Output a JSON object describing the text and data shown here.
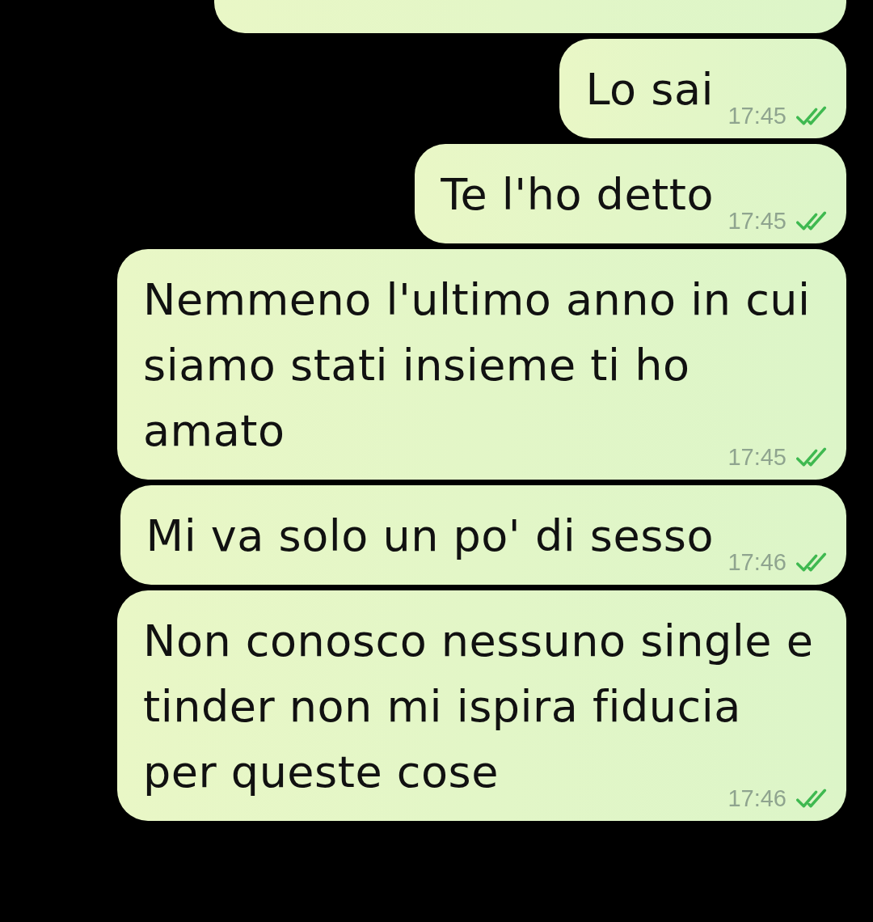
{
  "messages": [
    {
      "text": "Lo sai",
      "time": "17:45",
      "read": true
    },
    {
      "text": "Te l'ho detto",
      "time": "17:45",
      "read": true
    },
    {
      "text": "Nemmeno l'ultimo anno in cui siamo stati insieme ti ho amato",
      "time": "17:45",
      "read": true
    },
    {
      "text": "Mi va solo un po' di sesso",
      "time": "17:46",
      "read": true
    },
    {
      "text": "Non conosco nessuno single e tinder non mi ispira fiducia per queste cose",
      "time": "17:46",
      "read": true
    }
  ]
}
